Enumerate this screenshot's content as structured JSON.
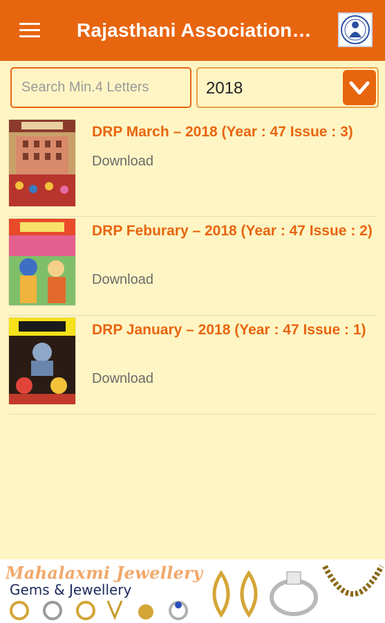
{
  "header": {
    "title": "Rajasthani Association…",
    "logo_icon": "association-logo-icon",
    "menu_icon": "hamburger-menu-icon"
  },
  "filters": {
    "search_placeholder": "Search Min.4 Letters",
    "search_value": "",
    "year_selected": "2018",
    "dropdown_icon": "chevron-down-icon"
  },
  "issues": [
    {
      "title": "DRP March – 2018 (Year : 47 Issue : 3)",
      "download_label": "Download"
    },
    {
      "title": "DRP Feburary – 2018 (Year : 47 Issue : 2)",
      "download_label": "Download"
    },
    {
      "title": "DRP January – 2018 (Year : 47 Issue : 1)",
      "download_label": "Download"
    }
  ],
  "banner": {
    "brand": "Mahalaxmi Jewellery",
    "tagline": "Gems & Jewellery"
  },
  "colors": {
    "accent": "#e8650f",
    "background": "#fff5c4",
    "download_text": "#6a6a6a"
  }
}
